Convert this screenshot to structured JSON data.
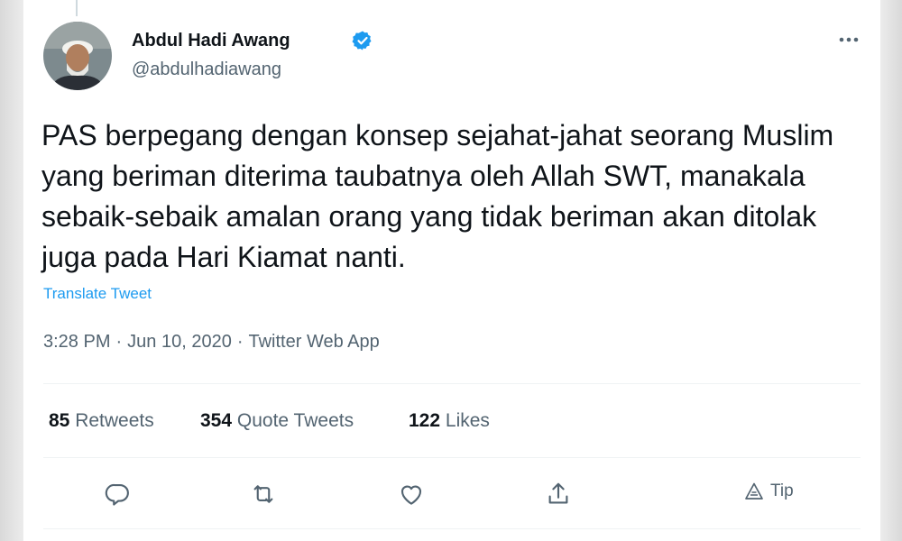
{
  "author": {
    "name": "Abdul Hadi Awang",
    "handle": "@abdulhadiawang"
  },
  "tweet": {
    "text": "PAS berpegang dengan konsep sejahat-jahat seorang Muslim yang beriman diterima taubatnya oleh Allah SWT, manakala sebaik-sebaik amalan orang yang tidak beriman akan ditolak juga pada Hari Kiamat nanti.",
    "translate_label": "Translate Tweet",
    "time": "3:28 PM",
    "date": "Jun 10, 2020",
    "source": "Twitter Web App",
    "separator": "·"
  },
  "stats": {
    "retweets_count": "85",
    "retweets_label": "Retweets",
    "quotes_count": "354",
    "quotes_label": "Quote Tweets",
    "likes_count": "122",
    "likes_label": "Likes"
  },
  "actions": {
    "tip_label": "Tip"
  },
  "icons": {
    "verified": "verified-badge-icon",
    "more": "more-horizontal-icon",
    "reply": "reply-icon",
    "retweet": "retweet-icon",
    "like": "heart-icon",
    "share": "share-icon",
    "tip": "tip-icon"
  },
  "colors": {
    "accent": "#1d9bf0",
    "secondary_text": "#536471",
    "primary_text": "#0f1419"
  }
}
